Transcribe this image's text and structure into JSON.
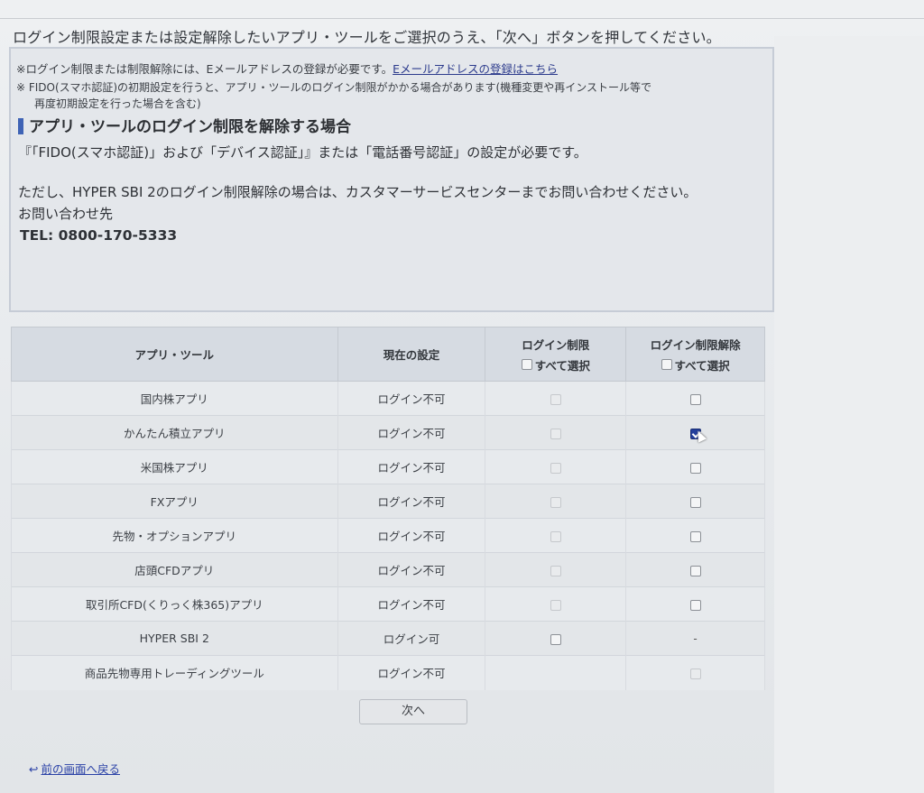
{
  "header": {
    "instruction": "ログイン制限設定または設定解除したいアプリ・ツールをご選択のうえ、「次へ」ボタンを押してください。"
  },
  "notes": {
    "note1_prefix": "※ログイン制限または制限解除には、Eメールアドレスの登録が必要です。",
    "note1_link": "Eメールアドレスの登録はこちら",
    "note2_line1": "※ FIDO(スマホ認証)の初期設定を行うと、アプリ・ツールのログイン制限がかかる場合があります(機種変更や再インストール等で",
    "note2_line2": "再度初期設定を行った場合を含む)"
  },
  "section": {
    "title": "アプリ・ツールのログイン制限を解除する場合",
    "line1": "『「FIDO(スマホ認証)」および「デバイス認証」』または「電話番号認証」の設定が必要です。",
    "line2": "ただし、HYPER SBI 2のログイン制限解除の場合は、カスタマーサービスセンターまでお問い合わせください。",
    "contact_label": "お問い合わせ先",
    "tel": "TEL: 0800-170-5333"
  },
  "table": {
    "headers": {
      "app": "アプリ・ツール",
      "current": "現在の設定",
      "restrict": "ログイン制限",
      "release": "ログイン制限解除",
      "select_all": "すべて選択"
    },
    "rows": [
      {
        "app": "国内株アプリ",
        "status": "ログイン不可",
        "restrict": "disabled",
        "release": "unchecked"
      },
      {
        "app": "かんたん積立アプリ",
        "status": "ログイン不可",
        "restrict": "disabled",
        "release": "checked"
      },
      {
        "app": "米国株アプリ",
        "status": "ログイン不可",
        "restrict": "disabled",
        "release": "unchecked"
      },
      {
        "app": "FXアプリ",
        "status": "ログイン不可",
        "restrict": "disabled",
        "release": "unchecked"
      },
      {
        "app": "先物・オプションアプリ",
        "status": "ログイン不可",
        "restrict": "disabled",
        "release": "unchecked"
      },
      {
        "app": "店頭CFDアプリ",
        "status": "ログイン不可",
        "restrict": "disabled",
        "release": "unchecked"
      },
      {
        "app": "取引所CFD(くりっく株365)アプリ",
        "status": "ログイン不可",
        "restrict": "disabled",
        "release": "unchecked"
      },
      {
        "app": "HYPER SBI 2",
        "status": "ログイン可",
        "restrict": "unchecked",
        "release": "-"
      },
      {
        "app": "商品先物専用トレーディングツール",
        "status": "ログイン不可",
        "restrict": "none",
        "release": "disabled"
      }
    ]
  },
  "next_button_label": "次へ",
  "back_link_label": "前の画面へ戻る",
  "back_link_icon": "return-arrow-icon"
}
